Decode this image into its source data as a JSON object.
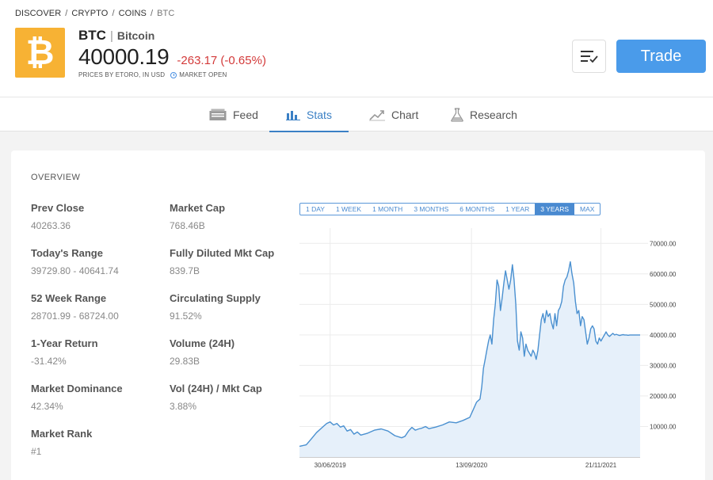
{
  "breadcrumb": {
    "discover": "DISCOVER",
    "crypto": "CRYPTO",
    "coins": "COINS",
    "current": "BTC",
    "sep": "/"
  },
  "coin": {
    "logo_glyph": "₿",
    "ticker": "BTC",
    "name": "Bitcoin",
    "price": "40000.19",
    "change": "-263.17 (-0.65%)",
    "prices_by": "PRICES BY ETORO, IN USD",
    "market_status": "MARKET OPEN",
    "brand_color": "#f7b234",
    "change_color": "#d33a3a"
  },
  "actions": {
    "trade_label": "Trade",
    "watchlist_icon": "list-check-icon"
  },
  "tabs": [
    {
      "label": "Feed",
      "icon": "newspaper-icon"
    },
    {
      "label": "Stats",
      "icon": "bar-chart-icon",
      "active": true
    },
    {
      "label": "Chart",
      "icon": "line-chart-icon"
    },
    {
      "label": "Research",
      "icon": "flask-icon"
    }
  ],
  "overview": {
    "title": "OVERVIEW",
    "stats": [
      {
        "label": "Prev Close",
        "value": "40263.36"
      },
      {
        "label": "Today's Range",
        "value": "39729.80 - 40641.74"
      },
      {
        "label": "52 Week Range",
        "value": "28701.99 - 68724.00"
      },
      {
        "label": "1-Year Return",
        "value": "-31.42%"
      },
      {
        "label": "Market Dominance",
        "value": "42.34%"
      },
      {
        "label": "Market Rank",
        "value": "#1"
      },
      {
        "label": "Market Cap",
        "value": "768.46B"
      },
      {
        "label": "Fully Diluted Mkt Cap",
        "value": "839.7B"
      },
      {
        "label": "Circulating Supply",
        "value": "91.52%"
      },
      {
        "label": "Volume (24H)",
        "value": "29.83B"
      },
      {
        "label": "Vol (24H) / Mkt Cap",
        "value": "3.88%"
      }
    ]
  },
  "periods": [
    "1 DAY",
    "1 WEEK",
    "1 MONTH",
    "3 MONTHS",
    "6 MONTHS",
    "1 YEAR",
    "3 YEARS",
    "MAX"
  ],
  "active_period": "3 YEARS",
  "chart_data": {
    "type": "area",
    "ylim": [
      0,
      75000
    ],
    "yticks": [
      10000,
      20000,
      30000,
      40000,
      50000,
      60000,
      70000
    ],
    "ytick_labels": [
      "10000.00",
      "20000.00",
      "30000.00",
      "40000.00",
      "50000.00",
      "60000.00",
      "70000.00"
    ],
    "xtick_labels": [
      "30/06/2019",
      "13/09/2020",
      "21/11/2021"
    ],
    "xtick_positions": [
      0.09,
      0.505,
      0.885
    ],
    "line_color": "#4a90d0",
    "fill_color": "#e6f0fa",
    "x": [
      0,
      0.02,
      0.035,
      0.05,
      0.065,
      0.08,
      0.09,
      0.1,
      0.11,
      0.12,
      0.13,
      0.14,
      0.15,
      0.16,
      0.17,
      0.18,
      0.2,
      0.22,
      0.24,
      0.26,
      0.28,
      0.3,
      0.31,
      0.32,
      0.33,
      0.34,
      0.35,
      0.36,
      0.37,
      0.38,
      0.4,
      0.42,
      0.44,
      0.46,
      0.48,
      0.5,
      0.51,
      0.52,
      0.53,
      0.535,
      0.54,
      0.545,
      0.55,
      0.555,
      0.56,
      0.565,
      0.57,
      0.575,
      0.58,
      0.585,
      0.59,
      0.595,
      0.6,
      0.605,
      0.61,
      0.615,
      0.62,
      0.625,
      0.63,
      0.635,
      0.64,
      0.645,
      0.65,
      0.655,
      0.66,
      0.665,
      0.67,
      0.675,
      0.68,
      0.685,
      0.69,
      0.695,
      0.7,
      0.705,
      0.71,
      0.715,
      0.72,
      0.725,
      0.73,
      0.735,
      0.74,
      0.745,
      0.75,
      0.755,
      0.76,
      0.765,
      0.77,
      0.775,
      0.78,
      0.785,
      0.79,
      0.795,
      0.8,
      0.805,
      0.81,
      0.815,
      0.82,
      0.825,
      0.83,
      0.835,
      0.84,
      0.845,
      0.85,
      0.855,
      0.86,
      0.865,
      0.87,
      0.875,
      0.88,
      0.885,
      0.89,
      0.895,
      0.9,
      0.905,
      0.91,
      0.915,
      0.92,
      0.925,
      0.93,
      0.935,
      0.94,
      0.945,
      0.95,
      0.955,
      0.96,
      0.965,
      0.97,
      0.975,
      0.98,
      0.985,
      0.99,
      0.995,
      1.0
    ],
    "values": [
      3500,
      4000,
      6000,
      8000,
      9500,
      11000,
      11500,
      10500,
      11000,
      9800,
      10200,
      8500,
      9000,
      7500,
      8200,
      7200,
      7800,
      8800,
      9200,
      8500,
      7000,
      6300,
      6800,
      8500,
      9700,
      8800,
      9200,
      9500,
      10000,
      9300,
      9800,
      10500,
      11500,
      11200,
      12000,
      13000,
      15500,
      18000,
      19000,
      23000,
      29000,
      32000,
      35000,
      38000,
      40000,
      37000,
      45000,
      50000,
      58000,
      56000,
      48000,
      52000,
      57000,
      61000,
      58000,
      55000,
      58000,
      63000,
      58000,
      50000,
      38000,
      35000,
      41000,
      39000,
      33000,
      37000,
      35000,
      34000,
      33000,
      35000,
      34000,
      32000,
      35000,
      40000,
      45000,
      47000,
      44000,
      48000,
      46000,
      47000,
      44000,
      42000,
      47000,
      43000,
      48000,
      49000,
      51000,
      56000,
      58000,
      59000,
      61000,
      64000,
      60000,
      57000,
      51000,
      47000,
      48000,
      43000,
      46000,
      45000,
      41000,
      37000,
      39000,
      42000,
      43000,
      42000,
      38000,
      37000,
      39000,
      38000,
      39000,
      40000,
      41000,
      40000,
      39500,
      40000,
      40500,
      40000,
      40200,
      40000,
      39800,
      40000,
      40100,
      40000,
      40000,
      39900,
      40000,
      40000,
      40000,
      40000,
      40000,
      40000,
      40000
    ],
    "grid": true
  }
}
